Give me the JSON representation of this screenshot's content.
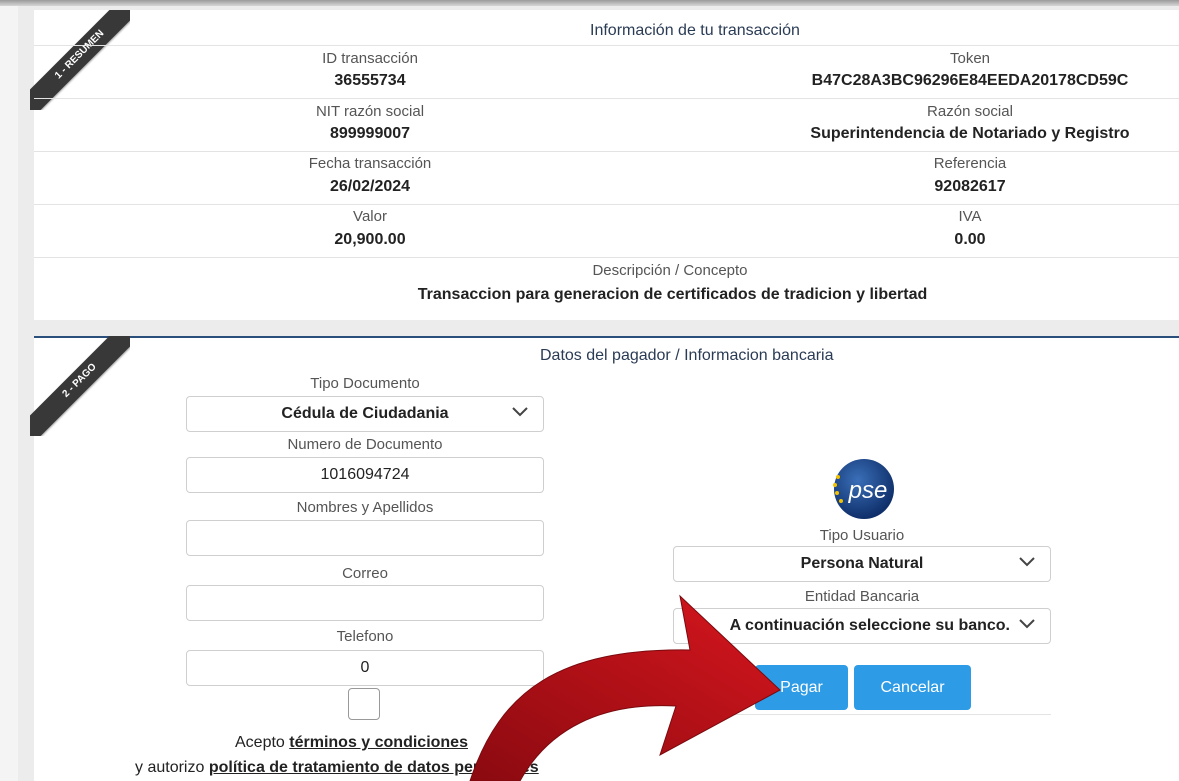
{
  "summary": {
    "ribbon": "1 - RESUMEN",
    "title": "Información de tu transacción",
    "id_label": "ID transacción",
    "id_value": "36555734",
    "token_label": "Token",
    "token_value": "B47C28A3BC96296E84EEDA20178CD59C",
    "nit_label": "NIT razón social",
    "nit_value": "899999007",
    "razon_label": "Razón social",
    "razon_value": "Superintendencia de Notariado y Registro",
    "fecha_label": "Fecha transacción",
    "fecha_value": "26/02/2024",
    "ref_label": "Referencia",
    "ref_value": "92082617",
    "valor_label": "Valor",
    "valor_value": "20,900.00",
    "iva_label": "IVA",
    "iva_value": "0.00",
    "desc_label": "Descripción / Concepto",
    "desc_value": "Transaccion para generacion de certificados de tradicion y libertad"
  },
  "payment": {
    "ribbon": "2 - PAGO",
    "title": "Datos del pagador / Informacion bancaria",
    "tipo_doc_label": "Tipo Documento",
    "tipo_doc_value": "Cédula de Ciudadania",
    "num_doc_label": "Numero de Documento",
    "num_doc_value": "1016094724",
    "nombres_label": "Nombres y Apellidos",
    "nombres_value": "",
    "correo_label": "Correo",
    "correo_value": "",
    "telefono_label": "Telefono",
    "telefono_value": "0",
    "pse_logo_text": "pse",
    "tipo_usuario_label": "Tipo Usuario",
    "tipo_usuario_value": "Persona Natural",
    "entidad_label": "Entidad Bancaria",
    "entidad_value": "A continuación seleccione su banco.",
    "pagar_label": "Pagar",
    "cancelar_label": "Cancelar",
    "accept_text": "Acepto",
    "terms_link": "términos y condiciones",
    "authorize_text": "y autorizo",
    "privacy_link": "política de tratamiento de datos personales"
  },
  "colors": {
    "accent": "#2d9be6",
    "arrow": "#c4121a",
    "ribbon": "#383838",
    "section_line": "#2a4f7a"
  }
}
